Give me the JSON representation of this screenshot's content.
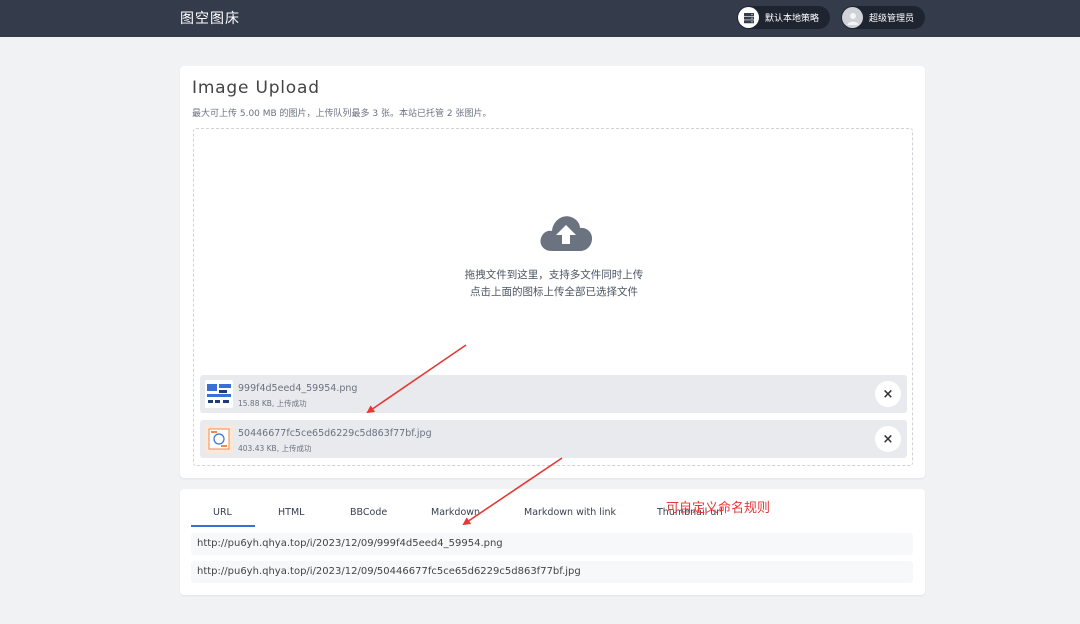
{
  "navbar": {
    "brand": "图空图床",
    "strategy_label": "默认本地策略",
    "user_label": "超级管理员"
  },
  "upload": {
    "title": "Image Upload",
    "subtitle": "最大可上传 5.00 MB 的图片，上传队列最多 3 张。本站已托管 2 张图片。",
    "hint_line1": "拖拽文件到这里，支持多文件同时上传",
    "hint_line2": "点击上面的图标上传全部已选择文件",
    "files": [
      {
        "name": "999f4d5eed4_59954.png",
        "meta": "15.88 KB, 上传成功"
      },
      {
        "name": "50446677fc5ce65d6229c5d863f77bf.jpg",
        "meta": "403.43 KB, 上传成功"
      }
    ],
    "remove_symbol": "×"
  },
  "links": {
    "tabs": [
      "URL",
      "HTML",
      "BBCode",
      "Markdown",
      "Markdown with link",
      "Thumbnail url"
    ],
    "active_tab": "URL",
    "annotation": "可自定义命名规则",
    "rows": [
      "http://pu6yh.qhya.top/i/2023/12/09/999f4d5eed4_59954.png",
      "http://pu6yh.qhya.top/i/2023/12/09/50446677fc5ce65d6229c5d863f77bf.jpg"
    ]
  },
  "colors": {
    "navbar": "#343b4b",
    "accent": "#3b6fd6",
    "annotation": "#e53935"
  }
}
